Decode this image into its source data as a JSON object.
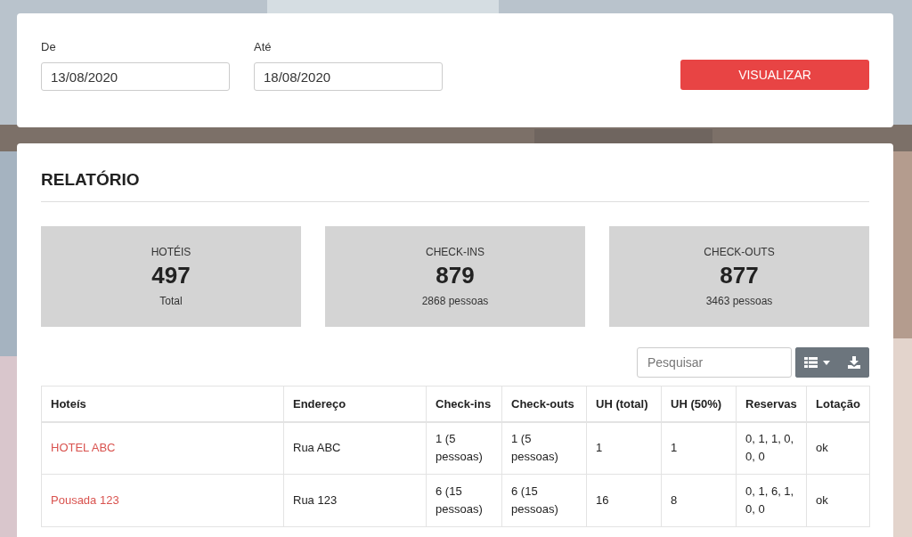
{
  "filters": {
    "fields": [
      {
        "label": "De",
        "value": "13/08/2020"
      },
      {
        "label": "Até",
        "value": "18/08/2020"
      }
    ],
    "button": "VISUALIZAR"
  },
  "report": {
    "title": "RELATÓRIO",
    "stats": [
      {
        "label": "HOTÉIS",
        "value": "497",
        "caption": "Total"
      },
      {
        "label": "CHECK-INS",
        "value": "879",
        "caption": "2868 pessoas"
      },
      {
        "label": "CHECK-OUTS",
        "value": "877",
        "caption": "3463 pessoas"
      }
    ],
    "search": {
      "placeholder": "Pesquisar"
    },
    "table": {
      "columns": [
        "Hoteís",
        "Endereço",
        "Check-ins",
        "Check-outs",
        "UH (total)",
        "UH (50%)",
        "Reservas",
        "Lotação"
      ],
      "rows": [
        [
          "HOTEL ABC",
          "Rua ABC",
          "1 (5 pessoas)",
          "1 (5 pessoas)",
          "1",
          "1",
          "0, 1, 1, 0, 0, 0",
          "ok"
        ],
        [
          "Pousada 123",
          "Rua 123",
          "6 (15 pessoas)",
          "6 (15 pessoas)",
          "16",
          "8",
          "0, 1, 6, 1, 0, 0",
          "ok"
        ]
      ]
    }
  }
}
